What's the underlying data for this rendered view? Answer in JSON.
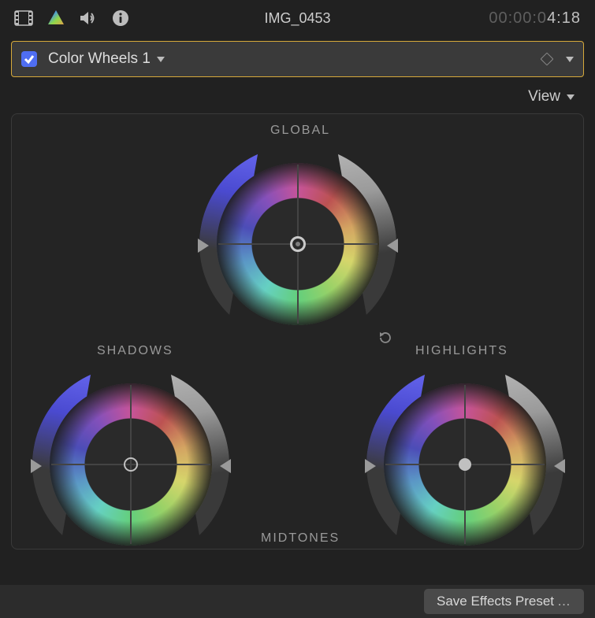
{
  "toolbar": {
    "icons": {
      "video": "video-inspector-icon",
      "color": "color-inspector-icon",
      "audio": "audio-inspector-icon",
      "info": "info-inspector-icon"
    },
    "clip_name": "IMG_0453",
    "timecode_dim": "00:00:0",
    "timecode_bright": "4:18"
  },
  "correction_strip": {
    "enabled": true,
    "name": "Color Wheels 1",
    "keyframe_icon": "keyframe-diamond-icon",
    "submenu_icon": "chevron-down-icon"
  },
  "view_menu": {
    "label": "View"
  },
  "wheels": {
    "global": {
      "label": "GLOBAL"
    },
    "shadows": {
      "label": "SHADOWS"
    },
    "midtones": {
      "label": "MIDTONES"
    },
    "highlights": {
      "label": "HIGHLIGHTS"
    }
  },
  "footer": {
    "save_preset_label": "Save Effects Preset"
  },
  "colors": {
    "accent_check": "#4f6ef2",
    "selection_border": "#d6a93a"
  }
}
